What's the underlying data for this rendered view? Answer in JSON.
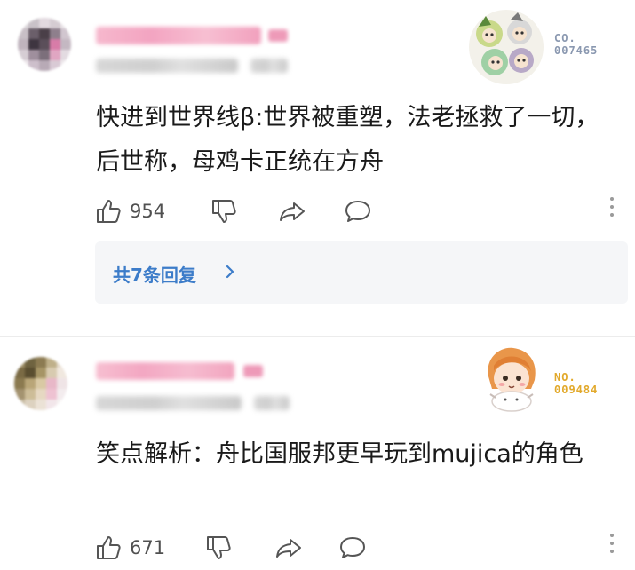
{
  "comments": [
    {
      "username": "",
      "meta": "",
      "text": "快进到世界线β:世界被重塑，法老拯救了一切，后世称，母鸡卡正统在方舟",
      "likes": "954",
      "fan_badge": {
        "line1": "CO.",
        "line2": "007465"
      },
      "replies_label": "共7条回复",
      "colors": {
        "badge_text": "#8a98b0",
        "name_blur": "#f3a9c4"
      }
    },
    {
      "username": "",
      "meta": "",
      "text": "笑点解析：舟比国服邦更早玩到mujica的角色",
      "likes": "671",
      "fan_badge": {
        "line1": "NO.",
        "line2": "009484"
      },
      "colors": {
        "badge_text": "#e2a92b",
        "name_blur": "#f3a9c4"
      }
    }
  ],
  "icons": [
    "thumbs-up-icon",
    "thumbs-down-icon",
    "share-icon",
    "comment-icon",
    "more-icon",
    "chevron-right-icon"
  ],
  "colors": {
    "link": "#3c7cc9",
    "icon": "#555555",
    "replies_bg": "#f5f6f8"
  }
}
